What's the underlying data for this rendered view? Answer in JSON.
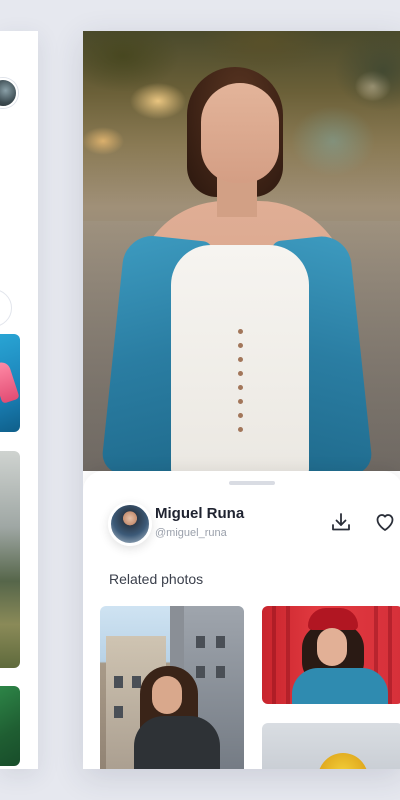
{
  "detail": {
    "author": {
      "name": "Miguel Runa",
      "handle": "@miguel_runa"
    },
    "actions": {
      "download_icon": "download-icon",
      "like_icon": "heart-icon"
    },
    "related": {
      "title": "Related photos"
    }
  },
  "colors": {
    "background": "#e6e8ef",
    "card": "#ffffff",
    "text_primary": "#1f2330",
    "text_secondary": "#9aa0ab"
  }
}
